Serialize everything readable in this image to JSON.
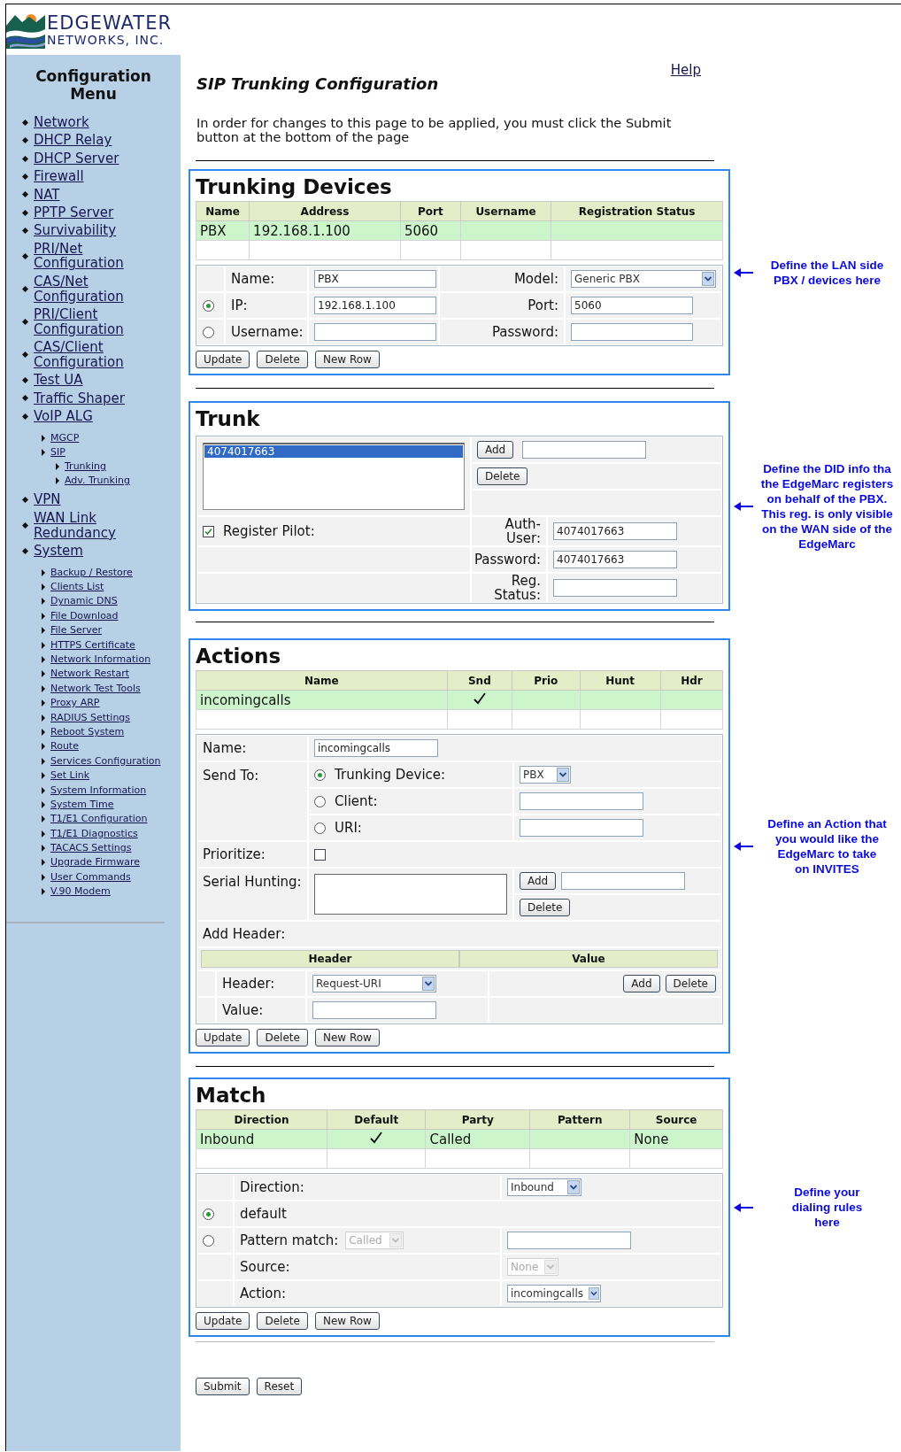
{
  "logo": {
    "line1": "EDGEWATER",
    "line2": "NETWORKS, INC."
  },
  "sidebar": {
    "title": "Configuration Menu",
    "items": [
      {
        "label": "Network"
      },
      {
        "label": "DHCP Relay"
      },
      {
        "label": "DHCP Server"
      },
      {
        "label": "Firewall"
      },
      {
        "label": "NAT"
      },
      {
        "label": "PPTP Server"
      },
      {
        "label": "Survivability"
      },
      {
        "label": "PRI/Net Configuration"
      },
      {
        "label": "CAS/Net Configuration"
      },
      {
        "label": "PRI/Client Configuration"
      },
      {
        "label": "CAS/Client Configuration"
      },
      {
        "label": "Test UA"
      },
      {
        "label": "Traffic Shaper"
      },
      {
        "label": "VoIP ALG",
        "children": [
          {
            "label": "MGCP"
          },
          {
            "label": "SIP",
            "children": [
              {
                "label": "Trunking"
              },
              {
                "label": "Adv. Trunking"
              }
            ]
          }
        ]
      },
      {
        "label": "VPN"
      },
      {
        "label": "WAN Link Redundancy"
      },
      {
        "label": "System",
        "children": [
          {
            "label": "Backup / Restore"
          },
          {
            "label": "Clients List"
          },
          {
            "label": "Dynamic DNS"
          },
          {
            "label": "File Download"
          },
          {
            "label": "File Server"
          },
          {
            "label": "HTTPS Certificate"
          },
          {
            "label": "Network Information"
          },
          {
            "label": "Network Restart"
          },
          {
            "label": "Network Test Tools"
          },
          {
            "label": "Proxy ARP"
          },
          {
            "label": "RADIUS Settings"
          },
          {
            "label": "Reboot System"
          },
          {
            "label": "Route"
          },
          {
            "label": "Services Configuration"
          },
          {
            "label": "Set Link"
          },
          {
            "label": "System Information"
          },
          {
            "label": "System Time"
          },
          {
            "label": "T1/E1 Configuration"
          },
          {
            "label": "T1/E1 Diagnostics"
          },
          {
            "label": "TACACS Settings"
          },
          {
            "label": "Upgrade Firmware"
          },
          {
            "label": "User Commands"
          },
          {
            "label": "V.90 Modem"
          }
        ]
      }
    ]
  },
  "page": {
    "title": "SIP Trunking Configuration",
    "help": "Help",
    "intro": "In order for changes to this page to be applied, you must click the Submit button at the bottom of the page"
  },
  "trunking_devices": {
    "title": "Trunking Devices",
    "table": {
      "columns": [
        "Name",
        "Address",
        "Port",
        "Username",
        "Registration Status"
      ],
      "rows": [
        {
          "cells": [
            "PBX",
            "192.168.1.100",
            "5060"
          ],
          "selected": true
        }
      ]
    },
    "form": {
      "name": {
        "label": "Name:",
        "value": "PBX"
      },
      "model": {
        "label": "Model:",
        "value": "Generic PBX"
      },
      "ip": {
        "label": "IP:",
        "value": "192.168.1.100",
        "selected": true
      },
      "port": {
        "label": "Port:",
        "value": "5060"
      },
      "username": {
        "label": "Username:",
        "selected": false
      },
      "password": {
        "label": "Password:"
      }
    },
    "buttons": [
      "Update",
      "Delete",
      "New Row"
    ],
    "note": {
      "lines": [
        "Define the LAN side",
        "PBX / devices here"
      ]
    }
  },
  "trunk": {
    "title": "Trunk",
    "list": [
      {
        "label": "4074017663",
        "selected": true
      }
    ],
    "add": "Add",
    "delete": "Delete",
    "register_pilot": {
      "label": "Register Pilot:",
      "checked": true
    },
    "auth_user": {
      "label": "Auth-User:",
      "value": "4074017663"
    },
    "password": {
      "label": "Password:",
      "value": "4074017663"
    },
    "reg_status": {
      "label": "Reg. Status:"
    },
    "note": {
      "lines": [
        "Define the DID info tha",
        "the EdgeMarc registers",
        "on behalf of the PBX.",
        "This reg. is only visible",
        "on the WAN side of the",
        "EdgeMarc"
      ]
    }
  },
  "actions": {
    "title": "Actions",
    "table": {
      "columns": [
        "Name",
        "Snd",
        "Prio",
        "Hunt",
        "Hdr"
      ],
      "rows": [
        {
          "name": "incomingcalls",
          "snd": true,
          "selected": true
        }
      ]
    },
    "form": {
      "name": {
        "label": "Name:",
        "value": "incomingcalls"
      },
      "send_to": {
        "label": "Send To:",
        "options": [
          {
            "label": "Trunking Device:",
            "selected": true,
            "kind": "select",
            "value": "PBX"
          },
          {
            "label": "Client:",
            "selected": false,
            "kind": "input"
          },
          {
            "label": "URI:",
            "selected": false,
            "kind": "input"
          }
        ]
      },
      "prioritize": {
        "label": "Prioritize:",
        "checked": false
      },
      "serial_hunting": {
        "label": "Serial Hunting:",
        "add": "Add",
        "delete": "Delete"
      },
      "add_header": {
        "label": "Add Header:",
        "columns": [
          "Header",
          "Value"
        ],
        "header": {
          "label": "Header:",
          "value": "Request-URI"
        },
        "add": "Add",
        "delete": "Delete",
        "value": {
          "label": "Value:"
        }
      }
    },
    "buttons": [
      "Update",
      "Delete",
      "New Row"
    ],
    "note": {
      "lines": [
        "Define an Action that",
        "you would like the",
        "EdgeMarc to take",
        "on INVITES"
      ]
    }
  },
  "match": {
    "title": "Match",
    "table": {
      "columns": [
        "Direction",
        "Default",
        "Party",
        "Pattern",
        "Source"
      ],
      "rows": [
        {
          "direction": "Inbound",
          "default": true,
          "party": "Called",
          "source": "None",
          "selected": true
        }
      ]
    },
    "form": {
      "direction": {
        "label": "Direction:",
        "value": "Inbound"
      },
      "default": {
        "label": "default",
        "selected": true
      },
      "pattern_match": {
        "label": "Pattern match:",
        "value": "Called",
        "disabled": true,
        "selected": false
      },
      "source": {
        "label": "Source:",
        "value": "None",
        "disabled": true
      },
      "action": {
        "label": "Action:",
        "value": "incomingcalls"
      }
    },
    "buttons": [
      "Update",
      "Delete",
      "New Row"
    ],
    "note": {
      "lines": [
        "Define your",
        "dialing rules",
        "here"
      ]
    }
  },
  "footer_buttons": [
    "Submit",
    "Reset"
  ]
}
